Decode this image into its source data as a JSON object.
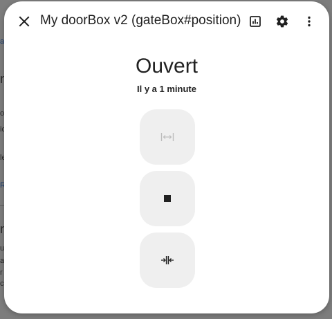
{
  "background": {
    "fragments": [
      {
        "text": "a",
        "class": "link"
      },
      {
        "text": "n",
        "class": "big"
      },
      {
        "text": "ox",
        "class": ""
      },
      {
        "text": "ic",
        "class": ""
      },
      {
        "text": "le",
        "class": ""
      },
      {
        "text": "R",
        "class": "link"
      },
      {
        "text": "n",
        "class": "big"
      },
      {
        "text": "ut",
        "class": ""
      },
      {
        "text": "aj",
        "class": ""
      },
      {
        "text": "r",
        "class": ""
      },
      {
        "text": "c",
        "class": ""
      }
    ]
  },
  "dialog": {
    "title": "My doorBox v2 (gateBox#position)",
    "icons": {
      "close": "close-icon",
      "history": "chart-box-icon",
      "settings": "gear-icon",
      "more": "dots-vertical-icon"
    },
    "state": "Ouvert",
    "relative_time": "Il y a 1 minute",
    "controls": [
      {
        "name": "open",
        "icon": "gate-open-icon",
        "enabled": false
      },
      {
        "name": "stop",
        "icon": "stop-icon",
        "enabled": true
      },
      {
        "name": "close",
        "icon": "gate-close-icon",
        "enabled": true
      }
    ],
    "colors": {
      "background": "#ffffff",
      "button_background": "#efefef",
      "text": "#212121",
      "disabled_icon": "#bdbdbd"
    }
  }
}
